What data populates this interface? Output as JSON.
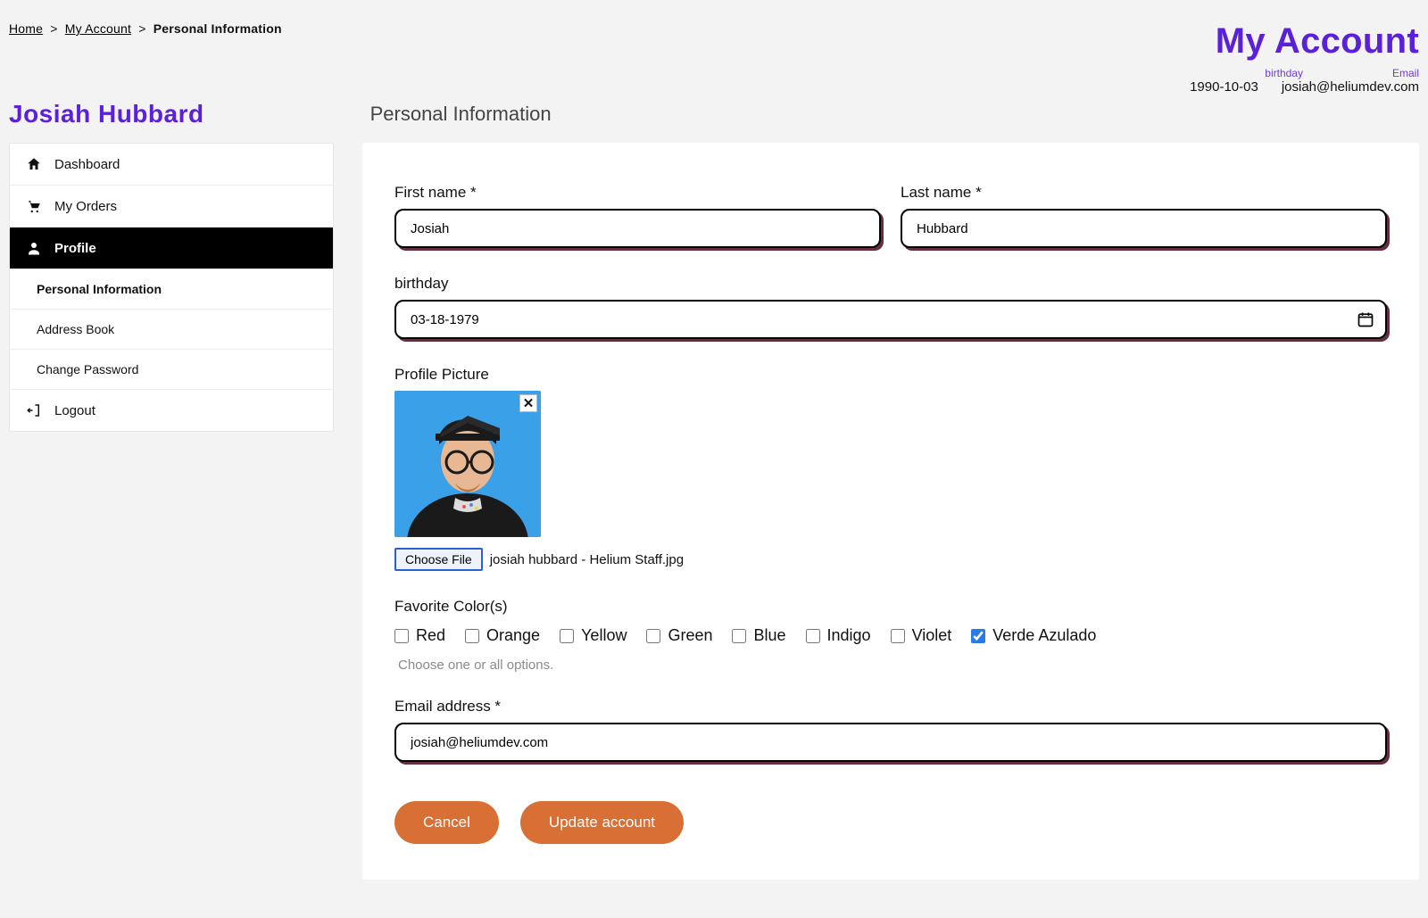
{
  "breadcrumb": {
    "home": "Home",
    "account": "My Account",
    "current": "Personal Information"
  },
  "header": {
    "title": "My Account",
    "birthday_label": "birthday",
    "email_label": "Email",
    "birthday_value": "1990-10-03",
    "email_value": "josiah@heliumdev.com"
  },
  "user_name": "Josiah Hubbard",
  "page_heading": "Personal Information",
  "sidebar": {
    "dashboard": "Dashboard",
    "orders": "My Orders",
    "profile": "Profile",
    "sub_personal": "Personal Information",
    "sub_address": "Address Book",
    "sub_password": "Change Password",
    "logout": "Logout"
  },
  "form": {
    "first_label": "First name *",
    "first_value": "Josiah",
    "last_label": "Last name *",
    "last_value": "Hubbard",
    "birthday_label": "birthday",
    "birthday_value": "03-18-1979",
    "pp_label": "Profile Picture",
    "choose_file": "Choose File",
    "file_name": "josiah hubbard - Helium Staff.jpg",
    "colors_label": "Favorite Color(s)",
    "colors": [
      {
        "label": "Red",
        "checked": false
      },
      {
        "label": "Orange",
        "checked": false
      },
      {
        "label": "Yellow",
        "checked": false
      },
      {
        "label": "Green",
        "checked": false
      },
      {
        "label": "Blue",
        "checked": false
      },
      {
        "label": "Indigo",
        "checked": false
      },
      {
        "label": "Violet",
        "checked": false
      },
      {
        "label": "Verde Azulado",
        "checked": true
      }
    ],
    "colors_help": "Choose one or all options.",
    "email_label": "Email address *",
    "email_value": "josiah@heliumdev.com",
    "cancel": "Cancel",
    "update": "Update account"
  }
}
